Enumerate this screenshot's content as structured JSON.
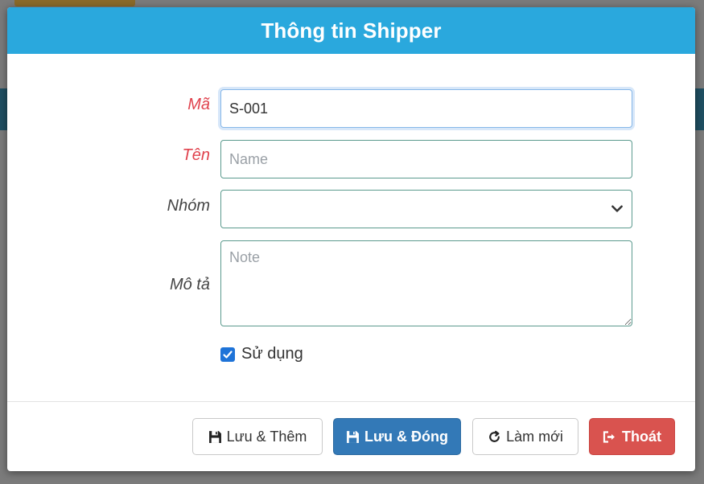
{
  "dialog": {
    "title": "Thông tin Shipper"
  },
  "form": {
    "code": {
      "label": "Mã",
      "value": "S-001",
      "required": true
    },
    "name": {
      "label": "Tên",
      "value": "",
      "placeholder": "Name",
      "required": true
    },
    "group": {
      "label": "Nhóm",
      "value": "",
      "required": false
    },
    "description": {
      "label": "Mô tả",
      "value": "",
      "placeholder": "Note",
      "required": false
    },
    "active": {
      "label": "Sử dụng",
      "checked": true
    }
  },
  "footer": {
    "save_add_label": "Lưu & Thêm",
    "save_close_label": "Lưu & Đóng",
    "refresh_label": "Làm mới",
    "exit_label": "Thoát"
  },
  "colors": {
    "header": "#2aa8dd",
    "required_label": "#e0434e",
    "primary_button": "#3379b7",
    "danger_button": "#d9534f",
    "checkbox": "#1e73d8"
  }
}
